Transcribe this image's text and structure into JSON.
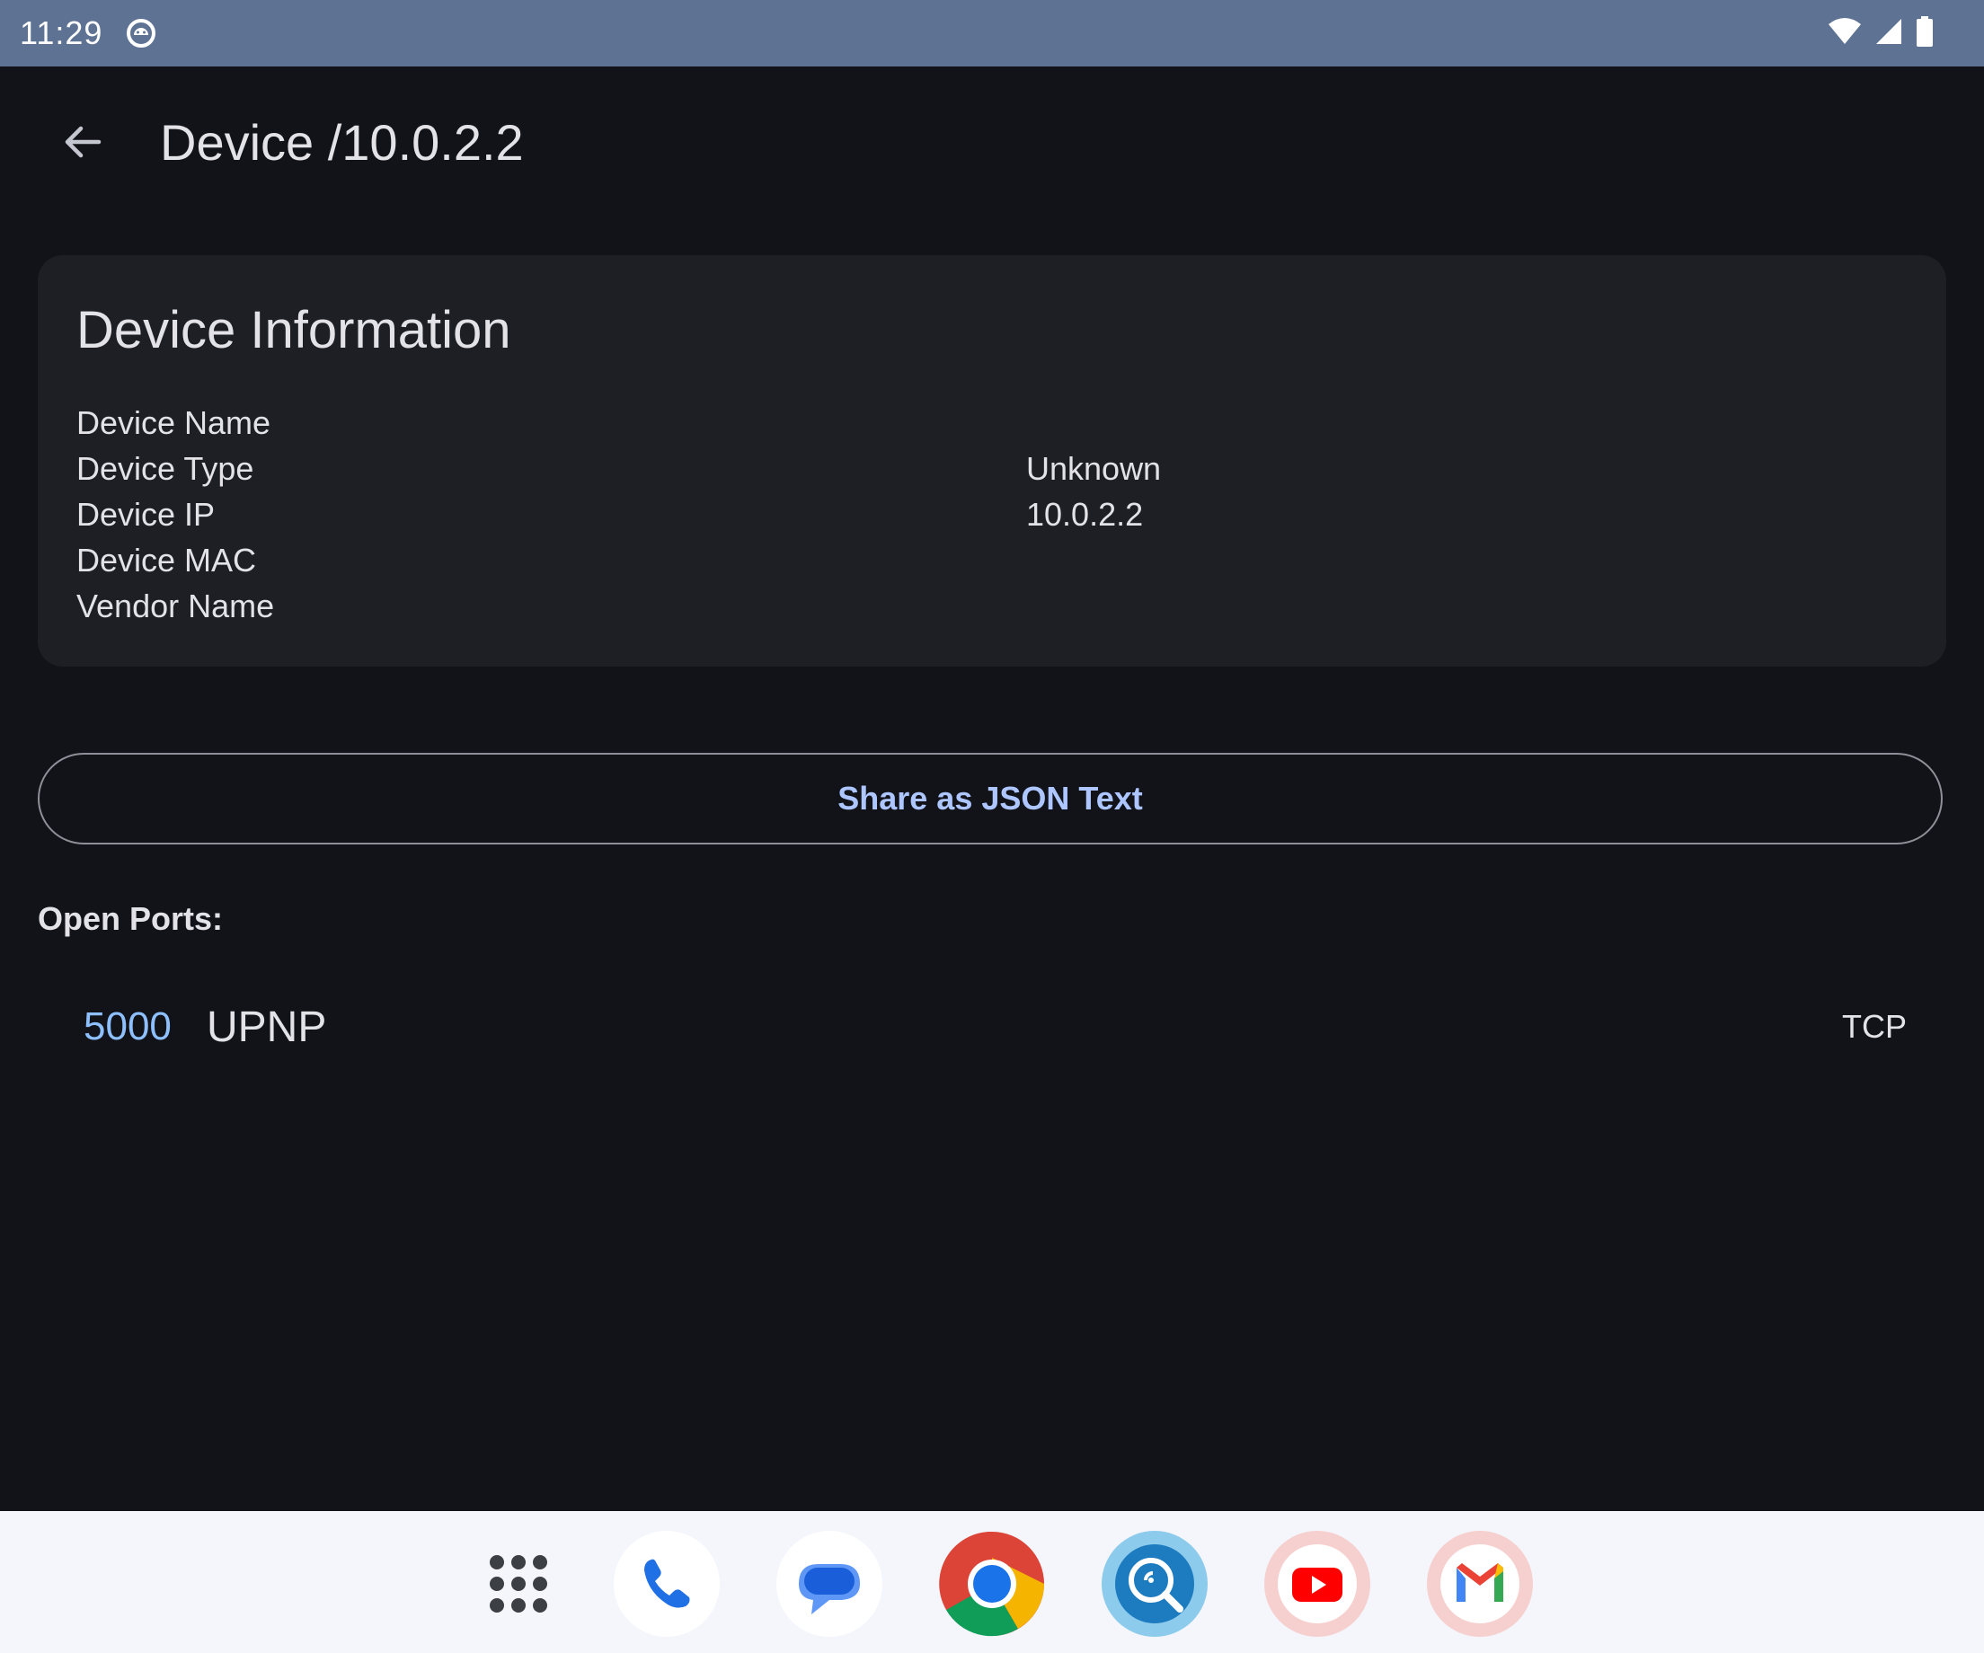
{
  "status_bar": {
    "time": "11:29",
    "icons": [
      "android-notification-icon",
      "wifi-icon",
      "cellular-signal-icon",
      "battery-icon"
    ]
  },
  "app_bar": {
    "back_icon": "arrow-back-icon",
    "title": "Device /10.0.2.2"
  },
  "device_info": {
    "title": "Device Information",
    "rows": [
      {
        "label": "Device Name",
        "value": ""
      },
      {
        "label": "Device Type",
        "value": "Unknown"
      },
      {
        "label": "Device IP",
        "value": "10.0.2.2"
      },
      {
        "label": "Device MAC",
        "value": ""
      },
      {
        "label": "Vendor Name",
        "value": ""
      }
    ]
  },
  "share_button": {
    "label": "Share as JSON Text"
  },
  "open_ports": {
    "label": "Open Ports:",
    "ports": [
      {
        "number": "5000",
        "service": "UPNP",
        "protocol": "TCP"
      }
    ]
  },
  "dock": {
    "apps": [
      "app-drawer-icon",
      "phone-icon",
      "messages-icon",
      "chrome-icon",
      "network-scanner-icon",
      "youtube-icon",
      "gmail-icon"
    ]
  },
  "colors": {
    "background": "#121318",
    "card": "#1d1f25",
    "status_bar": "#5e7394",
    "accent": "#adc6ff",
    "port_number": "#8ec0ff",
    "dock": "#f4f6fb"
  }
}
